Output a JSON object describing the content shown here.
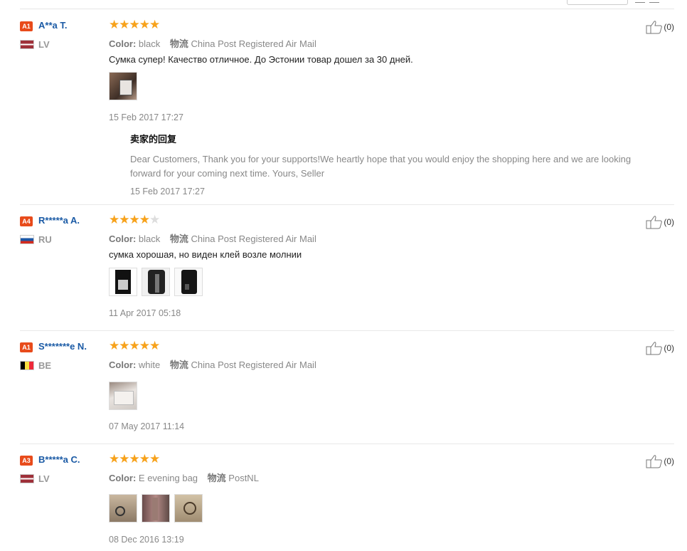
{
  "reviews": [
    {
      "badge": "A1",
      "name": "A**a T.",
      "country": "LV",
      "flag_colors": [
        "#9e3039",
        "#ffffff",
        "#9e3039"
      ],
      "rating": 5,
      "color_label": "Color:",
      "color_value": "black",
      "logistics_label": "物流",
      "logistics_value": "China Post Registered Air Mail",
      "text": "Сумка супер! Качество отличное. До Эстонии товар дошел за 30 дней.",
      "date": "15 Feb 2017 17:27",
      "likes": "(0)",
      "reply": {
        "title": "卖家的回复",
        "text_line1": "Dear Customers, Thank you for your supports!We heartly hope that you would enjoy the shopping here and we are looking",
        "text_line2": "forward for your coming next time. Yours, Seller",
        "date": "15 Feb 2017 17:27"
      }
    },
    {
      "badge": "A4",
      "name": "R*****a A.",
      "country": "RU",
      "flag_colors": [
        "#ffffff",
        "#1c57a5",
        "#d52b1e"
      ],
      "rating": 4,
      "color_label": "Color:",
      "color_value": "black",
      "logistics_label": "物流",
      "logistics_value": "China Post Registered Air Mail",
      "text": "сумка хорошая, но виден клей возле молнии",
      "date": "11 Apr 2017 05:18",
      "likes": "(0)"
    },
    {
      "badge": "A1",
      "name": "S*******e N.",
      "country": "BE",
      "flag_colors": [
        "#000000",
        "#fae042",
        "#ed2939"
      ],
      "rating": 5,
      "color_label": "Color:",
      "color_value": "white",
      "logistics_label": "物流",
      "logistics_value": "China Post Registered Air Mail",
      "text": "",
      "date": "07 May 2017 11:14",
      "likes": "(0)"
    },
    {
      "badge": "A3",
      "name": "B*****a C.",
      "country": "LV",
      "flag_colors": [
        "#9e3039",
        "#ffffff",
        "#9e3039"
      ],
      "rating": 5,
      "color_label": "Color:",
      "color_value": "E evening bag",
      "logistics_label": "物流",
      "logistics_value": "PostNL",
      "text": "",
      "date": "08 Dec 2016 13:19",
      "likes": "(0)"
    }
  ]
}
